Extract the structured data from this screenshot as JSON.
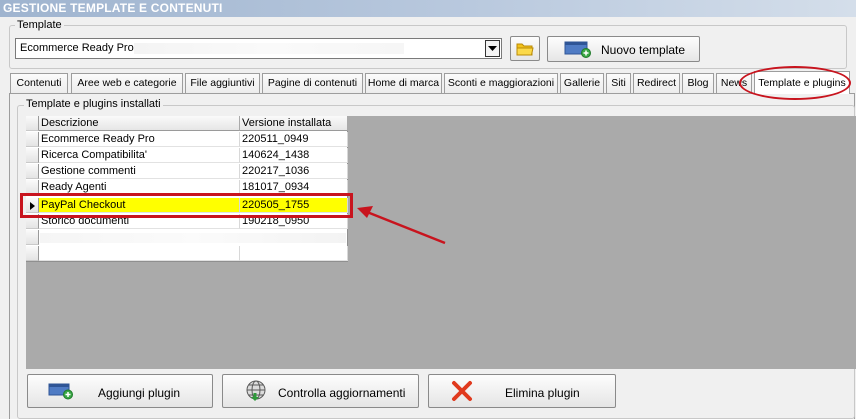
{
  "window": {
    "title": "GESTIONE TEMPLATE E CONTENUTI"
  },
  "template": {
    "legend": "Template",
    "selected": "Ecommerce Ready Pro",
    "new_button": "Nuovo template"
  },
  "tabs": [
    {
      "label": "Contenuti"
    },
    {
      "label": "Aree web e categorie"
    },
    {
      "label": "File aggiuntivi"
    },
    {
      "label": "Pagine di contenuti"
    },
    {
      "label": "Home di marca"
    },
    {
      "label": "Sconti e maggiorazioni"
    },
    {
      "label": "Gallerie"
    },
    {
      "label": "Siti"
    },
    {
      "label": "Redirect"
    },
    {
      "label": "Blog"
    },
    {
      "label": "News"
    },
    {
      "label": "Template e plugins",
      "active": true
    }
  ],
  "plugins": {
    "legend": "Template e plugins installati",
    "columns": [
      "Descrizione",
      "Versione installata"
    ],
    "rows": [
      {
        "description": "Ecommerce Ready Pro",
        "version": "220511_0949"
      },
      {
        "description": "Ricerca Compatibilita'",
        "version": "140624_1438"
      },
      {
        "description": "Gestione commenti",
        "version": "220217_1036"
      },
      {
        "description": "Ready Agenti",
        "version": "181017_0934"
      },
      {
        "description": "PayPal Checkout",
        "version": "220505_1755",
        "selected": true
      },
      {
        "description": "Storico documenti",
        "version": "190218_0950"
      }
    ]
  },
  "actions": {
    "add": "Aggiungi plugin",
    "check": "Controlla aggiornamenti",
    "delete": "Elimina plugin"
  },
  "colors": {
    "selection": "#ffff00",
    "annotation": "#c8141e"
  }
}
